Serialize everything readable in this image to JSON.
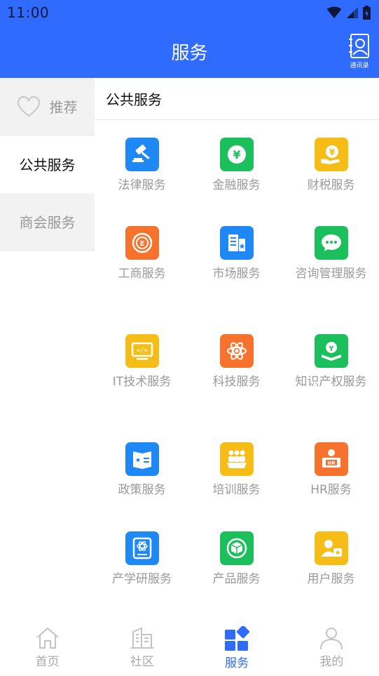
{
  "status_bar": {
    "time": "11:00"
  },
  "header": {
    "title": "服务",
    "contacts_label": "通讯录"
  },
  "sidebar": {
    "items": [
      {
        "label": "推荐"
      },
      {
        "label": "公共服务"
      },
      {
        "label": "商会服务"
      }
    ]
  },
  "content": {
    "section_title": "公共服务",
    "services": [
      {
        "label": "法律服务",
        "icon": "gavel-icon",
        "color": "#1e88f5"
      },
      {
        "label": "金融服务",
        "icon": "yuan-coin-icon",
        "color": "#1bc05d"
      },
      {
        "label": "财税服务",
        "icon": "hand-coin-icon",
        "color": "#f5bd15"
      },
      {
        "label": "工商服务",
        "icon": "business-seal-icon",
        "color": "#f7722d"
      },
      {
        "label": "市场服务",
        "icon": "market-doc-icon",
        "color": "#1e88f5"
      },
      {
        "label": "咨询管理服务",
        "icon": "chat-bubble-icon",
        "color": "#1bc05d"
      },
      {
        "label": "IT技术服务",
        "icon": "code-monitor-icon",
        "color": "#f5bd15"
      },
      {
        "label": "科技服务",
        "icon": "atom-icon",
        "color": "#f7722d"
      },
      {
        "label": "知识产权服务",
        "icon": "lightbulb-book-icon",
        "color": "#1bc05d"
      },
      {
        "label": "政策服务",
        "icon": "policy-book-icon",
        "color": "#1e88f5"
      },
      {
        "label": "培训服务",
        "icon": "audience-icon",
        "color": "#f5bd15"
      },
      {
        "label": "HR服务",
        "icon": "hr-desk-icon",
        "color": "#f7722d"
      },
      {
        "label": "产学研服务",
        "icon": "research-device-icon",
        "color": "#1e88f5"
      },
      {
        "label": "产品服务",
        "icon": "product-cube-icon",
        "color": "#1bc05d"
      },
      {
        "label": "用户服务",
        "icon": "user-card-icon",
        "color": "#f5bd15"
      }
    ]
  },
  "bottom_nav": {
    "items": [
      {
        "label": "首页"
      },
      {
        "label": "社区"
      },
      {
        "label": "服务"
      },
      {
        "label": "我的"
      }
    ]
  },
  "colors": {
    "primary": "#2f6bff",
    "blue": "#1e88f5",
    "green": "#1bc05d",
    "yellow": "#f5bd15",
    "orange": "#f7722d"
  }
}
